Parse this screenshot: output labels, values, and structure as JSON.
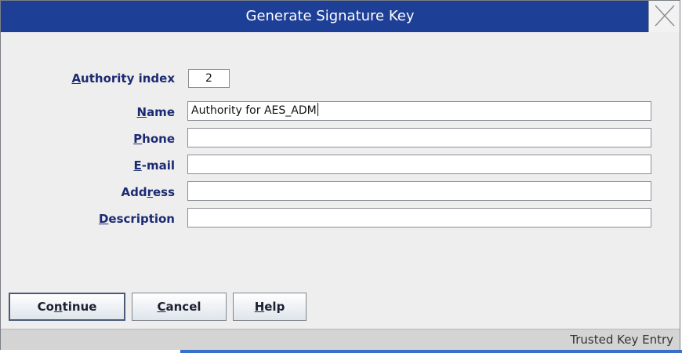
{
  "window": {
    "title": "Generate Signature Key"
  },
  "form": {
    "authority_index": {
      "label_pre": "",
      "label_key": "A",
      "label_post": "uthority index",
      "value": "2"
    },
    "name": {
      "label_pre": "",
      "label_key": "N",
      "label_post": "ame",
      "value": "Authority for AES_ADM"
    },
    "phone": {
      "label_pre": "",
      "label_key": "P",
      "label_post": "hone",
      "value": ""
    },
    "email": {
      "label_pre": "",
      "label_key": "E",
      "label_post": "-mail",
      "value": ""
    },
    "address": {
      "label_pre": "Add",
      "label_key": "r",
      "label_post": "ess",
      "value": ""
    },
    "description": {
      "label_pre": "",
      "label_key": "D",
      "label_post": "escription",
      "value": ""
    }
  },
  "buttons": {
    "continue": {
      "pre": "Co",
      "key": "n",
      "post": "tinue"
    },
    "cancel": {
      "pre": "",
      "key": "C",
      "post": "ancel"
    },
    "help": {
      "pre": "",
      "key": "H",
      "post": "elp"
    }
  },
  "status": {
    "text": "Trusted Key Entry"
  },
  "icons": {
    "close": "close-icon"
  }
}
